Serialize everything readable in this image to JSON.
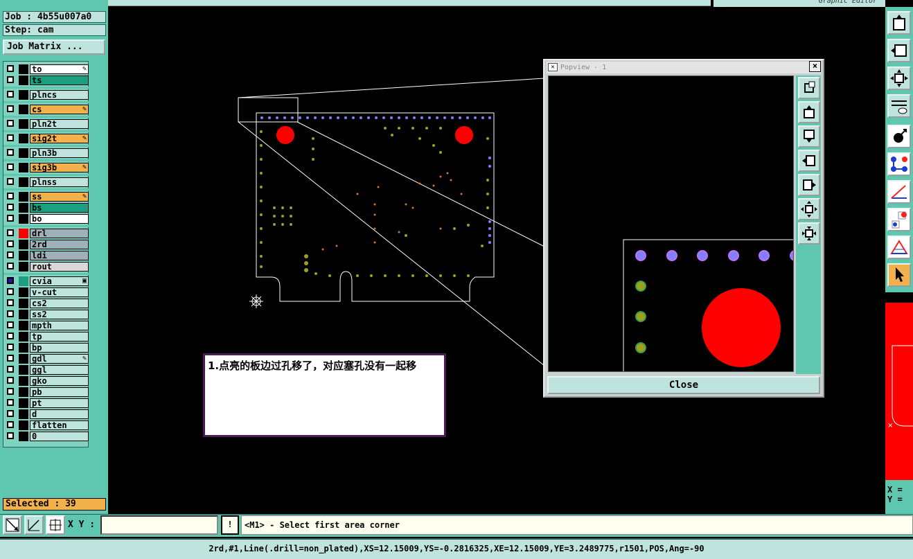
{
  "job_label": "Job : 4b55u007a0",
  "step_label": "Step: cam",
  "job_matrix_button": "Job Matrix ...",
  "top_right_title": "Graphic Editor",
  "layers": [
    {
      "name": "to",
      "color": "#ffffff",
      "flag": "✎",
      "swatch": "#000"
    },
    {
      "name": "ts",
      "color": "#1aa080",
      "flag": "",
      "swatch": "#000"
    },
    {
      "name": "plncs",
      "color": "#bfe3dd",
      "flag": "",
      "swatch": "#000"
    },
    {
      "name": "cs",
      "color": "#f2b14a",
      "flag": "✎",
      "swatch": "#000"
    },
    {
      "name": "pln2t",
      "color": "#bfe3dd",
      "flag": "",
      "swatch": "#000"
    },
    {
      "name": "sig2t",
      "color": "#f2b14a",
      "flag": "✎",
      "swatch": "#000"
    },
    {
      "name": "pln3b",
      "color": "#bfe3dd",
      "flag": "",
      "swatch": "#000"
    },
    {
      "name": "sig3b",
      "color": "#f2b14a",
      "flag": "✎",
      "swatch": "#000"
    },
    {
      "name": "plnss",
      "color": "#bfe3dd",
      "flag": "",
      "swatch": "#000"
    },
    {
      "name": "ss",
      "color": "#f2b14a",
      "flag": "✎",
      "swatch": "#000"
    },
    {
      "name": "bs",
      "color": "#1aa080",
      "flag": "",
      "swatch": "#000"
    },
    {
      "name": "bo",
      "color": "#ffffff",
      "flag": "",
      "swatch": "#000"
    },
    {
      "name": "drl",
      "color": "#9fb0b8",
      "flag": "",
      "swatch": "#ff0000"
    },
    {
      "name": "2rd",
      "color": "#9fb0b8",
      "flag": "",
      "swatch": "#000"
    },
    {
      "name": "ldi",
      "color": "#9fb0b8",
      "flag": "",
      "swatch": "#000"
    },
    {
      "name": "rout",
      "color": "#d8d8d8",
      "flag": "",
      "swatch": "#000"
    },
    {
      "name": "cvia",
      "color": "#bfe3dd",
      "flag": "▣",
      "swatch": "#1aa080",
      "checked": true
    },
    {
      "name": "v-cut",
      "color": "#bfe3dd",
      "flag": "",
      "swatch": "#000"
    },
    {
      "name": "cs2",
      "color": "#bfe3dd",
      "flag": "",
      "swatch": "#000"
    },
    {
      "name": "ss2",
      "color": "#bfe3dd",
      "flag": "",
      "swatch": "#000"
    },
    {
      "name": "mpth",
      "color": "#bfe3dd",
      "flag": "",
      "swatch": "#000"
    },
    {
      "name": "tp",
      "color": "#bfe3dd",
      "flag": "",
      "swatch": "#000"
    },
    {
      "name": "bp",
      "color": "#bfe3dd",
      "flag": "",
      "swatch": "#000"
    },
    {
      "name": "gdl",
      "color": "#bfe3dd",
      "flag": "✎",
      "swatch": "#000"
    },
    {
      "name": "ggl",
      "color": "#bfe3dd",
      "flag": "",
      "swatch": "#000"
    },
    {
      "name": "gko",
      "color": "#bfe3dd",
      "flag": "",
      "swatch": "#000"
    },
    {
      "name": "pb",
      "color": "#bfe3dd",
      "flag": "",
      "swatch": "#000"
    },
    {
      "name": "pt",
      "color": "#bfe3dd",
      "flag": "",
      "swatch": "#000"
    },
    {
      "name": "d",
      "color": "#bfe3dd",
      "flag": "",
      "swatch": "#000"
    },
    {
      "name": "flatten",
      "color": "#bfe3dd",
      "flag": "",
      "swatch": "#000"
    },
    {
      "name": "0",
      "color": "#bfe3dd",
      "flag": "",
      "swatch": "#000"
    }
  ],
  "selected_label": "Selected : 39",
  "xy_label": "X Y :",
  "xy_input_value": "",
  "message_text": "<M1> - Select first area corner",
  "status_text": "2rd,#1,Line(.drill=non_plated),XS=12.15009,YS=-0.2816325,XE=12.15009,YE=3.2489775,r1501,POS,Ang=-90",
  "popview": {
    "title": "Popview - 1",
    "close_label": "Close"
  },
  "note_text": "1.点亮的板边过孔移了，对应塞孔没有一起移",
  "coords_label": "X =\nY ="
}
